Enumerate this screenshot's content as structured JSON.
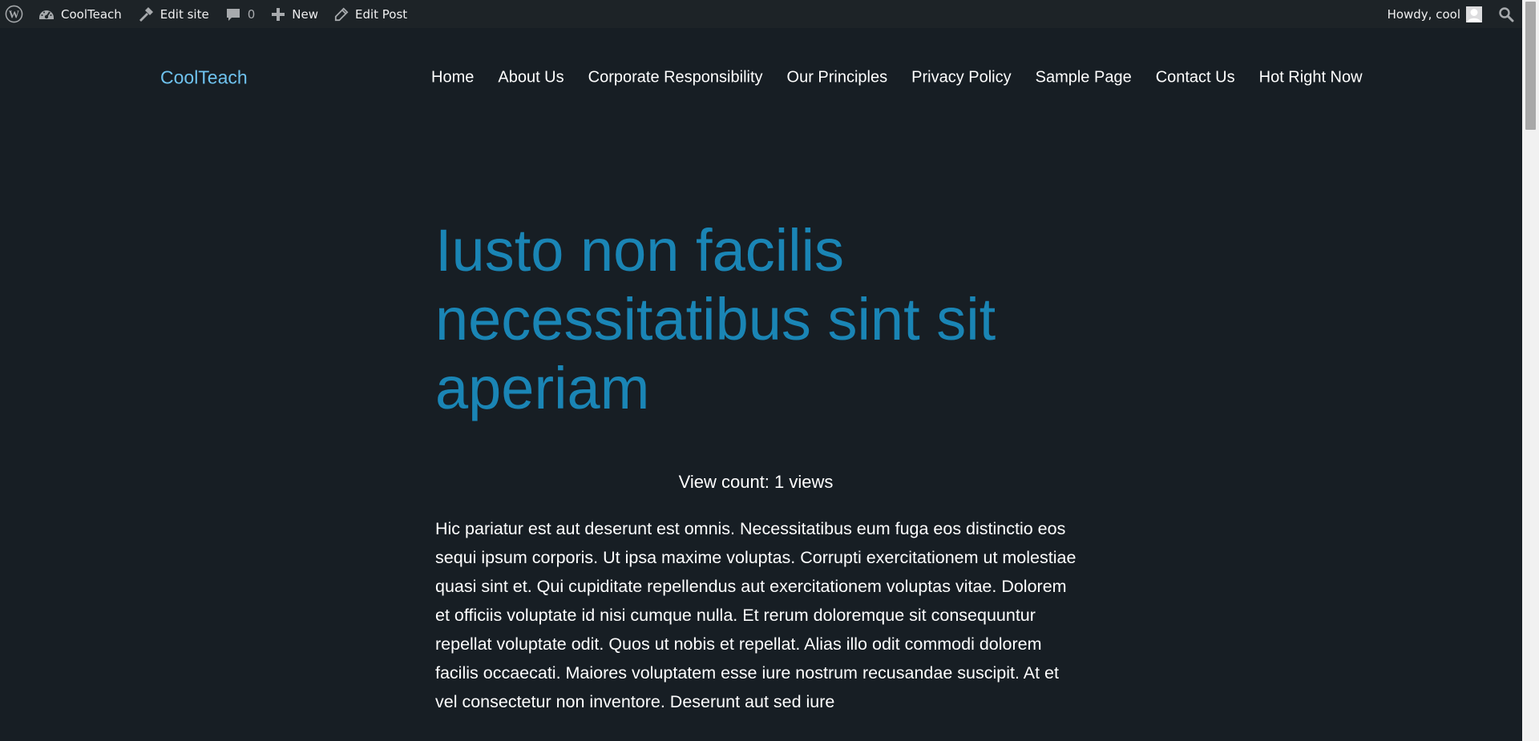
{
  "admin_bar": {
    "site_name": "CoolTeach",
    "edit_site": "Edit site",
    "comments_count": "0",
    "new_label": "New",
    "edit_post": "Edit Post",
    "howdy": "Howdy, cool"
  },
  "header": {
    "site_title": "CoolTeach",
    "nav": [
      "Home",
      "About Us",
      "Corporate Responsibility",
      "Our Principles",
      "Privacy Policy",
      "Sample Page",
      "Contact Us",
      "Hot Right Now"
    ]
  },
  "post": {
    "title": "Iusto non facilis necessitatibus sint sit aperiam",
    "view_count": "View count: 1 views",
    "body": "Hic pariatur est aut deserunt est omnis. Necessitatibus eum fuga eos distinctio eos sequi ipsum corporis. Ut ipsa maxime voluptas. Corrupti exercitationem ut molestiae quasi sint et. Qui cupiditate repellendus aut exercitationem voluptas vitae. Dolorem et officiis voluptate id nisi cumque nulla. Et rerum doloremque sit consequuntur repellat voluptate odit. Quos ut nobis et repellat. Alias illo odit commodi dolorem facilis occaecati. Maiores voluptatem esse iure nostrum recusandae suscipit. At et vel consectetur non inventore. Deserunt aut sed iure"
  },
  "colors": {
    "background": "#171e24",
    "admin_bar": "#1d2327",
    "site_title": "#6fc3ef",
    "post_title": "#1a85b5",
    "text": "#ffffff"
  },
  "icons": {
    "wordpress": "wordpress-logo-icon",
    "dashboard": "dashboard-icon",
    "edit_site": "hammer-icon",
    "comments": "comment-bubble-icon",
    "new": "plus-icon",
    "edit_post": "pencil-icon",
    "avatar": "user-avatar",
    "search": "search-icon"
  }
}
